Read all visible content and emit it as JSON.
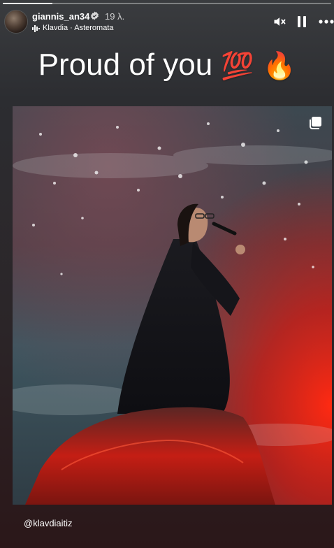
{
  "story": {
    "progress": 0.15,
    "user": {
      "username": "giannis_an34",
      "verified": true,
      "time_ago": "19 λ."
    },
    "music": {
      "icon": "music-bars-icon",
      "label": "Klavdia · Asteromata"
    },
    "controls": {
      "mute_icon": "volume-muted-icon",
      "pause_icon": "pause-icon",
      "more_icon": "more-options-icon"
    },
    "caption": {
      "text": "Proud of you",
      "emojis": [
        "💯",
        "🔥"
      ]
    },
    "post": {
      "multi_icon": "carousel-multiple-icon",
      "mention": "@klavdiaitiz"
    }
  },
  "colors": {
    "accent_red": "#e5241c",
    "verified_blue": "#3b9bf0"
  }
}
